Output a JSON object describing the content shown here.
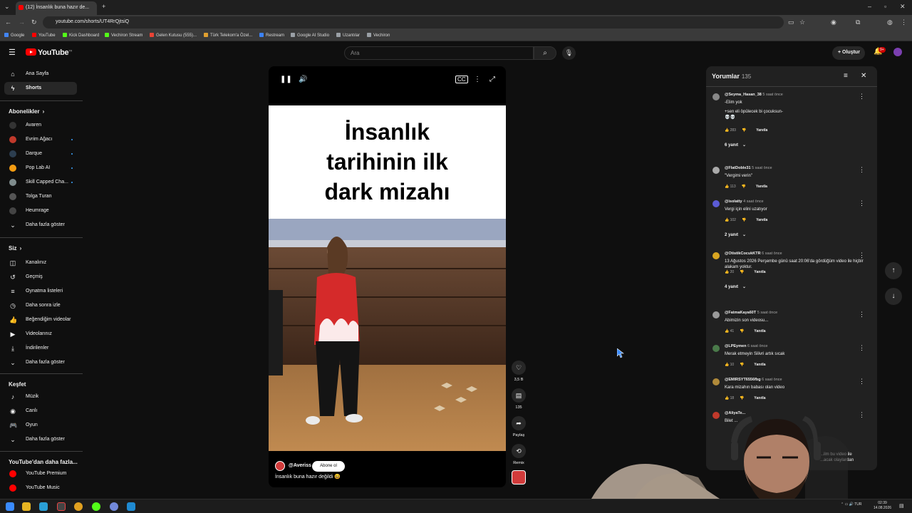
{
  "browser": {
    "tab_title": "(12) İnsanlık buna hazır de...",
    "url": "youtube.com/shorts/UT4RrQjtsiQ",
    "bookmarks": [
      {
        "label": "Google",
        "color": "#4285f4"
      },
      {
        "label": "YouTube",
        "color": "#ff0000"
      },
      {
        "label": "Kick Dashboard",
        "color": "#53fc18"
      },
      {
        "label": "Vechiron Stream",
        "color": "#53fc18"
      },
      {
        "label": "Gelen Kutusu (555)...",
        "color": "#ea4335"
      },
      {
        "label": "Türk Telekom'a Özel...",
        "color": "#e0a030"
      },
      {
        "label": "Restream",
        "color": "#3b82f6"
      },
      {
        "label": "Google AI Studio",
        "color": "#9aa0a6"
      },
      {
        "label": "Uzantılar",
        "color": "#9aa0a6"
      },
      {
        "label": "Vechiron",
        "color": "#9aa0a6"
      }
    ]
  },
  "header": {
    "logo": "YouTube",
    "logo_country": "TR",
    "search_placeholder": "Ara",
    "create_label": "Oluştur",
    "notif_count": "9+"
  },
  "sidebar": {
    "main": [
      {
        "label": "Ana Sayfa",
        "icon": "home-icon"
      },
      {
        "label": "Shorts",
        "icon": "shorts-icon"
      }
    ],
    "subs_header": "Abonelikler",
    "subs": [
      {
        "label": "Avaren",
        "color": "#333333",
        "dot": false
      },
      {
        "label": "Evrim Ağacı",
        "color": "#c0392b",
        "dot": true
      },
      {
        "label": "Darque",
        "color": "#2c3e50",
        "dot": true
      },
      {
        "label": "Pop Lab AI",
        "color": "#f39c12",
        "dot": true
      },
      {
        "label": "Skill Capped Cha...",
        "color": "#7f8c8d",
        "dot": true
      },
      {
        "label": "Tolga Turan",
        "color": "#555555",
        "dot": false
      },
      {
        "label": "Heumrage",
        "color": "#444444",
        "dot": false
      }
    ],
    "show_more": "Daha fazla göster",
    "you_header": "Siz",
    "you": [
      {
        "label": "Kanalınız",
        "icon": "channel-icon"
      },
      {
        "label": "Geçmiş",
        "icon": "history-icon"
      },
      {
        "label": "Oynatma listeleri",
        "icon": "playlist-icon"
      },
      {
        "label": "Daha sonra izle",
        "icon": "clock-icon"
      },
      {
        "label": "Beğendiğim videolar",
        "icon": "like-icon"
      },
      {
        "label": "Videolarınız",
        "icon": "video-icon"
      },
      {
        "label": "İndirilenler",
        "icon": "download-icon"
      }
    ],
    "explore_header": "Keşfet",
    "explore": [
      {
        "label": "Müzik",
        "icon": "music-icon"
      },
      {
        "label": "Canlı",
        "icon": "live-icon"
      },
      {
        "label": "Oyun",
        "icon": "gaming-icon"
      }
    ],
    "more_header": "YouTube'dan daha fazla...",
    "more": [
      {
        "label": "YouTube Premium"
      },
      {
        "label": "YouTube Music"
      }
    ]
  },
  "short": {
    "overlay_title": [
      "İnsanlık",
      "tarihinin ilk",
      "dark mizahı"
    ],
    "channel": "@Averiss",
    "subscribe_label": "Abone ol",
    "caption": "İnsanlık buna hazır değildi 😆"
  },
  "actions": {
    "likes": "3,5 B",
    "comments": "135",
    "share": "Paylaş",
    "remix": "Remix"
  },
  "comments_panel": {
    "title": "Yorumlar",
    "count": "135",
    "reply_label": "Yanıtla",
    "items": [
      {
        "user": "@Seyma_Hasan_38",
        "time": "5 saat önce",
        "lines": [
          "-Elim yok",
          "",
          "+sen eli öpülecek bi çocuksun-",
          "💀💀"
        ],
        "likes": "283",
        "replies": "6 yanıt",
        "color": "#888888"
      },
      {
        "user": "@FlatDoble31",
        "time": "5 saat önce",
        "lines": [
          "\"Vergimi verin\""
        ],
        "likes": "113",
        "replies": "",
        "color": "#aaaaaa"
      },
      {
        "user": "@isolatty",
        "time": "4 saat önce",
        "lines": [
          "Vergi için elini uzatıyor"
        ],
        "likes": "102",
        "replies": "2 yanıt",
        "color": "#5b5bd6"
      },
      {
        "user": "@OtistikCocukKTR",
        "time": "6 saat önce",
        "lines": [
          "13 Ağustos 2026 Perşembe günü saat 20:06'da gördüğüm video ile hiçbir alakam yoktur."
        ],
        "likes": "20",
        "replies": "4 yanıt",
        "color": "#d9a521"
      },
      {
        "user": "@FatmaKaya60T",
        "time": "5 saat önce",
        "lines": [
          "Abimizin son videosu..."
        ],
        "likes": "41",
        "replies": "",
        "color": "#999999"
      },
      {
        "user": "@LPEymen",
        "time": "6 saat önce",
        "lines": [
          "Merak etmeyin Silivri artık sıcak"
        ],
        "likes": "10",
        "replies": "",
        "color": "#4a7a4a"
      },
      {
        "user": "@EMIRSYT6556fbg",
        "time": "6 saat önce",
        "lines": [
          "Kara mizahın babası olan video"
        ],
        "likes": "18",
        "replies": "",
        "color": "#b08a3a"
      },
      {
        "user": "@AliyaTe...",
        "time": "",
        "lines": [
          "Bilet ..."
        ],
        "likes": "",
        "replies": "",
        "color": "#c0392b"
      }
    ],
    "partial_text": [
      "...ilm bu video ile",
      "...acak olaylardan"
    ]
  },
  "taskbar": {
    "lang": "TUR",
    "time": "02:39",
    "date": "14.08.2026"
  }
}
